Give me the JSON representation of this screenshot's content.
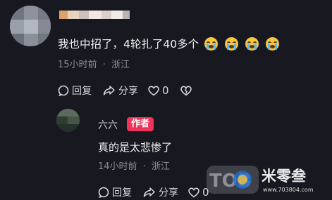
{
  "comment": {
    "text": "我也中招了，4轮扎了40多个",
    "emoji": [
      "loudly-crying-face",
      "loudly-crying-face",
      "loudly-crying-face",
      "loudly-crying-face"
    ],
    "time": "15小时前",
    "location": "浙江",
    "meta_sep": "·",
    "reply_label": "回复",
    "share_label": "分享",
    "like_count": "0"
  },
  "reply": {
    "author": "六六",
    "badge": "作者",
    "text": "真的是太悲惨了",
    "time": "14小时前",
    "location": "浙江",
    "meta_sep": "·",
    "reply_label": "回复",
    "share_label": "分享",
    "like_count": "0"
  },
  "watermark": {
    "logo": "TOB",
    "name": "米零叁",
    "url": "www.703804.com"
  },
  "colors": {
    "background": "#171820",
    "badge": "#f03459",
    "meta": "#8a8c95"
  }
}
